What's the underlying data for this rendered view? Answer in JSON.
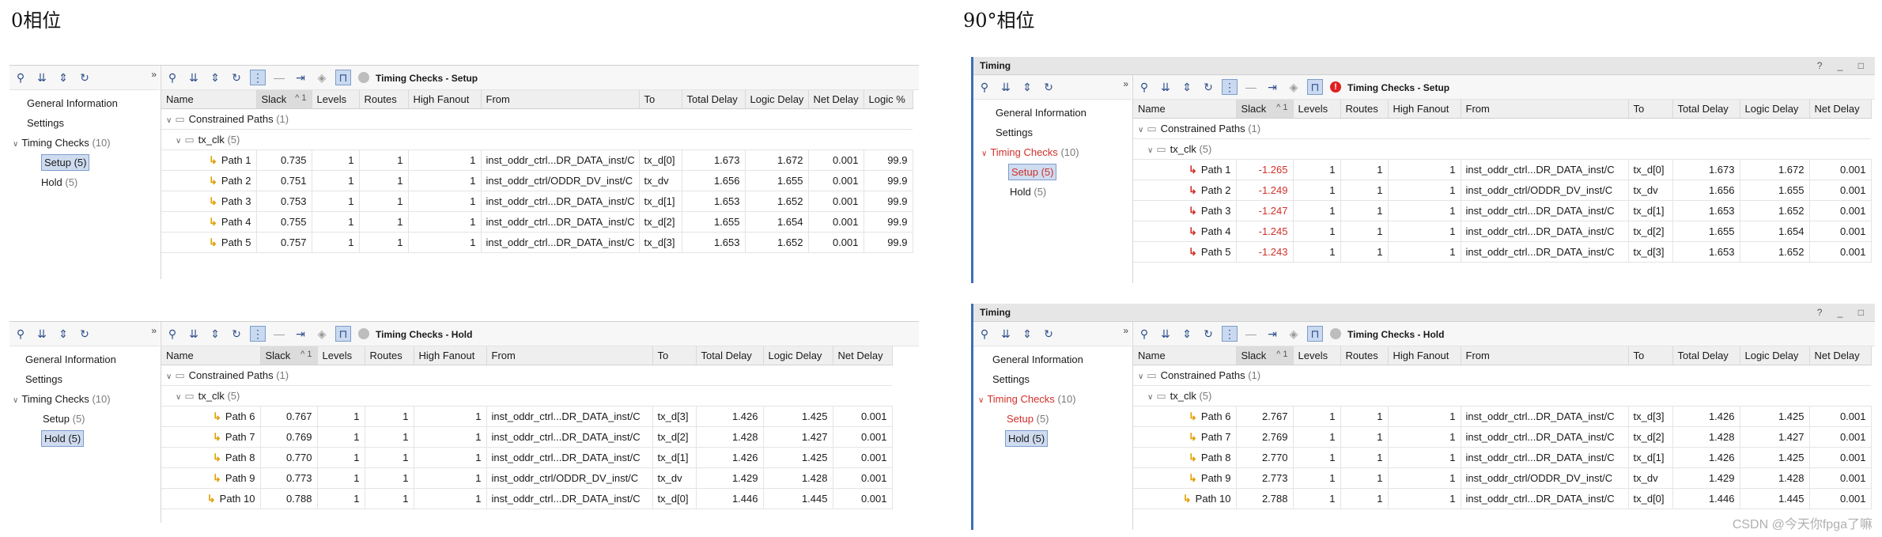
{
  "headings": {
    "left": "0相位",
    "right": "90°相位"
  },
  "columns": [
    "Name",
    "Slack",
    "Levels",
    "Routes",
    "High Fanout",
    "From",
    "To",
    "Total Delay",
    "Logic Delay",
    "Net Delay",
    "Logic %"
  ],
  "sort_indicator": "^ 1",
  "nav": {
    "general": "General Information",
    "settings": "Settings",
    "timing_checks": "Timing Checks",
    "timing_checks_count": "(10)",
    "setup": "Setup (5)",
    "setup_label": "Setup",
    "setup_count": "(5)",
    "hold": "Hold (5)",
    "hold_label": "Hold",
    "hold_count": "(5)"
  },
  "tree": {
    "constrained": "Constrained Paths",
    "constrained_count": "(1)",
    "clock": "tx_clk",
    "clock_count": "(5)"
  },
  "window_title": "Timing",
  "panels": {
    "p0_setup": {
      "title": "Timing Checks - Setup",
      "rows": [
        {
          "name": "Path 1",
          "slack": "0.735",
          "levels": "1",
          "routes": "1",
          "fanout": "1",
          "from": "inst_oddr_ctrl...DR_DATA_inst/C",
          "to": "tx_d[0]",
          "total": "1.673",
          "logic": "1.672",
          "net": "0.001",
          "pct": "99.9"
        },
        {
          "name": "Path 2",
          "slack": "0.751",
          "levels": "1",
          "routes": "1",
          "fanout": "1",
          "from": "inst_oddr_ctrl/ODDR_DV_inst/C",
          "to": "tx_dv",
          "total": "1.656",
          "logic": "1.655",
          "net": "0.001",
          "pct": "99.9"
        },
        {
          "name": "Path 3",
          "slack": "0.753",
          "levels": "1",
          "routes": "1",
          "fanout": "1",
          "from": "inst_oddr_ctrl...DR_DATA_inst/C",
          "to": "tx_d[1]",
          "total": "1.653",
          "logic": "1.652",
          "net": "0.001",
          "pct": "99.9"
        },
        {
          "name": "Path 4",
          "slack": "0.755",
          "levels": "1",
          "routes": "1",
          "fanout": "1",
          "from": "inst_oddr_ctrl...DR_DATA_inst/C",
          "to": "tx_d[2]",
          "total": "1.655",
          "logic": "1.654",
          "net": "0.001",
          "pct": "99.9"
        },
        {
          "name": "Path 5",
          "slack": "0.757",
          "levels": "1",
          "routes": "1",
          "fanout": "1",
          "from": "inst_oddr_ctrl...DR_DATA_inst/C",
          "to": "tx_d[3]",
          "total": "1.653",
          "logic": "1.652",
          "net": "0.001",
          "pct": "99.9"
        }
      ]
    },
    "p0_hold": {
      "title": "Timing Checks - Hold",
      "rows": [
        {
          "name": "Path 6",
          "slack": "0.767",
          "levels": "1",
          "routes": "1",
          "fanout": "1",
          "from": "inst_oddr_ctrl...DR_DATA_inst/C",
          "to": "tx_d[3]",
          "total": "1.426",
          "logic": "1.425",
          "net": "0.001"
        },
        {
          "name": "Path 7",
          "slack": "0.769",
          "levels": "1",
          "routes": "1",
          "fanout": "1",
          "from": "inst_oddr_ctrl...DR_DATA_inst/C",
          "to": "tx_d[2]",
          "total": "1.428",
          "logic": "1.427",
          "net": "0.001"
        },
        {
          "name": "Path 8",
          "slack": "0.770",
          "levels": "1",
          "routes": "1",
          "fanout": "1",
          "from": "inst_oddr_ctrl...DR_DATA_inst/C",
          "to": "tx_d[1]",
          "total": "1.426",
          "logic": "1.425",
          "net": "0.001"
        },
        {
          "name": "Path 9",
          "slack": "0.773",
          "levels": "1",
          "routes": "1",
          "fanout": "1",
          "from": "inst_oddr_ctrl/ODDR_DV_inst/C",
          "to": "tx_dv",
          "total": "1.429",
          "logic": "1.428",
          "net": "0.001"
        },
        {
          "name": "Path 10",
          "slack": "0.788",
          "levels": "1",
          "routes": "1",
          "fanout": "1",
          "from": "inst_oddr_ctrl...DR_DATA_inst/C",
          "to": "tx_d[0]",
          "total": "1.446",
          "logic": "1.445",
          "net": "0.001"
        }
      ]
    },
    "p90_setup": {
      "title": "Timing Checks - Setup",
      "rows": [
        {
          "name": "Path 1",
          "slack": "-1.265",
          "levels": "1",
          "routes": "1",
          "fanout": "1",
          "from": "inst_oddr_ctrl...DR_DATA_inst/C",
          "to": "tx_d[0]",
          "total": "1.673",
          "logic": "1.672",
          "net": "0.001"
        },
        {
          "name": "Path 2",
          "slack": "-1.249",
          "levels": "1",
          "routes": "1",
          "fanout": "1",
          "from": "inst_oddr_ctrl/ODDR_DV_inst/C",
          "to": "tx_dv",
          "total": "1.656",
          "logic": "1.655",
          "net": "0.001"
        },
        {
          "name": "Path 3",
          "slack": "-1.247",
          "levels": "1",
          "routes": "1",
          "fanout": "1",
          "from": "inst_oddr_ctrl...DR_DATA_inst/C",
          "to": "tx_d[1]",
          "total": "1.653",
          "logic": "1.652",
          "net": "0.001"
        },
        {
          "name": "Path 4",
          "slack": "-1.245",
          "levels": "1",
          "routes": "1",
          "fanout": "1",
          "from": "inst_oddr_ctrl...DR_DATA_inst/C",
          "to": "tx_d[2]",
          "total": "1.655",
          "logic": "1.654",
          "net": "0.001"
        },
        {
          "name": "Path 5",
          "slack": "-1.243",
          "levels": "1",
          "routes": "1",
          "fanout": "1",
          "from": "inst_oddr_ctrl...DR_DATA_inst/C",
          "to": "tx_d[3]",
          "total": "1.653",
          "logic": "1.652",
          "net": "0.001"
        }
      ]
    },
    "p90_hold": {
      "title": "Timing Checks - Hold",
      "rows": [
        {
          "name": "Path 6",
          "slack": "2.767",
          "levels": "1",
          "routes": "1",
          "fanout": "1",
          "from": "inst_oddr_ctrl...DR_DATA_inst/C",
          "to": "tx_d[3]",
          "total": "1.426",
          "logic": "1.425",
          "net": "0.001"
        },
        {
          "name": "Path 7",
          "slack": "2.769",
          "levels": "1",
          "routes": "1",
          "fanout": "1",
          "from": "inst_oddr_ctrl...DR_DATA_inst/C",
          "to": "tx_d[2]",
          "total": "1.428",
          "logic": "1.427",
          "net": "0.001"
        },
        {
          "name": "Path 8",
          "slack": "2.770",
          "levels": "1",
          "routes": "1",
          "fanout": "1",
          "from": "inst_oddr_ctrl...DR_DATA_inst/C",
          "to": "tx_d[1]",
          "total": "1.426",
          "logic": "1.425",
          "net": "0.001"
        },
        {
          "name": "Path 9",
          "slack": "2.773",
          "levels": "1",
          "routes": "1",
          "fanout": "1",
          "from": "inst_oddr_ctrl/ODDR_DV_inst/C",
          "to": "tx_dv",
          "total": "1.429",
          "logic": "1.428",
          "net": "0.001"
        },
        {
          "name": "Path 10",
          "slack": "2.788",
          "levels": "1",
          "routes": "1",
          "fanout": "1",
          "from": "inst_oddr_ctrl...DR_DATA_inst/C",
          "to": "tx_d[0]",
          "total": "1.446",
          "logic": "1.445",
          "net": "0.001"
        }
      ]
    }
  },
  "watermark": "CSDN @今天你fpga了嘛",
  "icons": [
    "search-icon",
    "collapse-all-icon",
    "expand-all-icon",
    "refresh-icon",
    "hierarchy-icon",
    "minus-icon",
    "export-icon",
    "diamond-icon",
    "waveform-icon"
  ],
  "colors": {
    "negative_slack": "#d0302a",
    "path_icon": "#e0a000",
    "selection": "#cfdcf0",
    "accent": "#3b6fb6"
  }
}
